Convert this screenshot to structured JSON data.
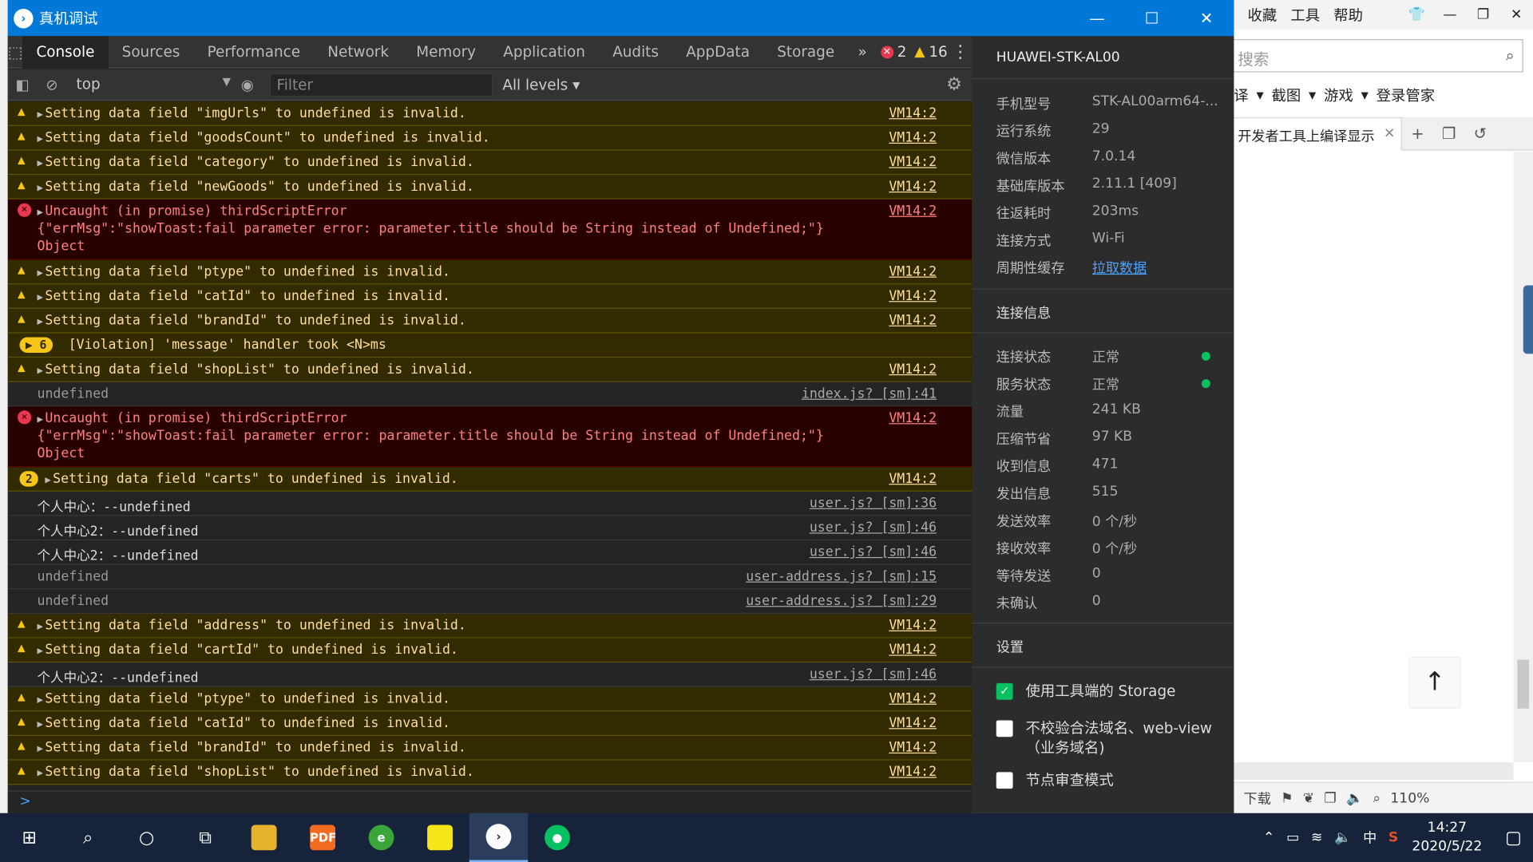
{
  "window": {
    "title": "真机调试",
    "minimize": "—",
    "maximize": "☐",
    "close": "✕"
  },
  "tabs": [
    "Console",
    "Sources",
    "Performance",
    "Network",
    "Memory",
    "Application",
    "Audits",
    "AppData",
    "Storage"
  ],
  "tabs_more": "»",
  "error_count": "2",
  "warning_count": "16",
  "toolbar": {
    "context": "top",
    "filter_placeholder": "Filter",
    "levels": "All levels ▾"
  },
  "logs": [
    {
      "type": "warn",
      "text": "Setting data field \"imgUrls\" to undefined is invalid.",
      "src": "VM14:2"
    },
    {
      "type": "warn",
      "text": "Setting data field \"goodsCount\" to undefined is invalid.",
      "src": "VM14:2"
    },
    {
      "type": "warn",
      "text": "Setting data field \"category\" to undefined is invalid.",
      "src": "VM14:2"
    },
    {
      "type": "warn",
      "text": "Setting data field \"newGoods\" to undefined is invalid.",
      "src": "VM14:2"
    },
    {
      "type": "err",
      "text": "Uncaught (in promise) thirdScriptError",
      "line2": "{\"errMsg\":\"showToast:fail parameter error: parameter.title should be String instead of Undefined;\"}",
      "line3": "Object",
      "src": "VM14:2"
    },
    {
      "type": "warn",
      "text": "Setting data field \"ptype\" to undefined is invalid.",
      "src": "VM14:2"
    },
    {
      "type": "warn",
      "text": "Setting data field \"catId\" to undefined is invalid.",
      "src": "VM14:2"
    },
    {
      "type": "warn",
      "text": "Setting data field \"brandId\" to undefined is invalid.",
      "src": "VM14:2"
    },
    {
      "type": "viol",
      "badge": "6",
      "text": "[Violation] 'message' handler took <N>ms",
      "src": ""
    },
    {
      "type": "warn",
      "text": "Setting data field \"shopList\" to undefined is invalid.",
      "src": "VM14:2"
    },
    {
      "type": "undef",
      "text": "undefined",
      "src": "index.js? [sm]:41"
    },
    {
      "type": "err",
      "text": "Uncaught (in promise) thirdScriptError",
      "line2": "{\"errMsg\":\"showToast:fail parameter error: parameter.title should be String instead of Undefined;\"}",
      "line3": "Object",
      "src": "VM14:2"
    },
    {
      "type": "warn",
      "count": "2",
      "text": "Setting data field \"carts\" to undefined is invalid.",
      "src": "VM14:2"
    },
    {
      "type": "info",
      "text": "个人中心：--undefined",
      "src": "user.js? [sm]:36"
    },
    {
      "type": "info",
      "text": "个人中心2：--undefined",
      "src": "user.js? [sm]:46"
    },
    {
      "type": "info",
      "text": "个人中心2：--undefined",
      "src": "user.js? [sm]:46"
    },
    {
      "type": "undef",
      "text": "undefined",
      "src": "user-address.js? [sm]:15"
    },
    {
      "type": "undef",
      "text": "undefined",
      "src": "user-address.js? [sm]:29"
    },
    {
      "type": "warn",
      "text": "Setting data field \"address\" to undefined is invalid.",
      "src": "VM14:2"
    },
    {
      "type": "warn",
      "text": "Setting data field \"cartId\" to undefined is invalid.",
      "src": "VM14:2"
    },
    {
      "type": "info",
      "text": "个人中心2：--undefined",
      "src": "user.js? [sm]:46"
    },
    {
      "type": "warn",
      "text": "Setting data field \"ptype\" to undefined is invalid.",
      "src": "VM14:2"
    },
    {
      "type": "warn",
      "text": "Setting data field \"catId\" to undefined is invalid.",
      "src": "VM14:2"
    },
    {
      "type": "warn",
      "text": "Setting data field \"brandId\" to undefined is invalid.",
      "src": "VM14:2"
    },
    {
      "type": "warn",
      "text": "Setting data field \"shopList\" to undefined is invalid.",
      "src": "VM14:2"
    }
  ],
  "prompt": ">",
  "device": {
    "name": "HUAWEI-STK-AL00",
    "info": [
      {
        "k": "手机型号",
        "v": "STK-AL00arm64-..."
      },
      {
        "k": "运行系统",
        "v": "29"
      },
      {
        "k": "微信版本",
        "v": "7.0.14"
      },
      {
        "k": "基础库版本",
        "v": "2.11.1 [409]"
      },
      {
        "k": "往返耗时",
        "v": "203ms"
      },
      {
        "k": "连接方式",
        "v": "Wi-Fi"
      },
      {
        "k": "周期性缓存",
        "v": "拉取数据",
        "link": true
      }
    ],
    "conn_title": "连接信息",
    "conn": [
      {
        "k": "连接状态",
        "v": "正常",
        "dot": true
      },
      {
        "k": "服务状态",
        "v": "正常",
        "dot": true
      },
      {
        "k": "流量",
        "v": "241 KB"
      },
      {
        "k": "压缩节省",
        "v": "97 KB"
      },
      {
        "k": "收到信息",
        "v": "471"
      },
      {
        "k": "发出信息",
        "v": "515"
      },
      {
        "k": "发送效率",
        "v": "0 个/秒"
      },
      {
        "k": "接收效率",
        "v": "0 个/秒"
      },
      {
        "k": "等待发送",
        "v": "0"
      },
      {
        "k": "未确认",
        "v": "0"
      }
    ],
    "settings_title": "设置",
    "settings": [
      {
        "label": "使用工具端的 Storage",
        "checked": true
      },
      {
        "label": "不校验合法域名、web-view（业务域名)",
        "checked": false
      },
      {
        "label": "节点审查模式",
        "checked": false
      }
    ]
  },
  "browser": {
    "menu": [
      "收藏",
      "工具",
      "帮助"
    ],
    "search_placeholder": "搜索",
    "links": [
      "译",
      "截图",
      "游戏",
      "登录管家"
    ],
    "tab_title": "开发者工具上编译显示",
    "status": [
      "下载",
      "110%"
    ]
  },
  "taskbar": {
    "ime": "中",
    "time": "14:27",
    "date": "2020/5/22"
  }
}
